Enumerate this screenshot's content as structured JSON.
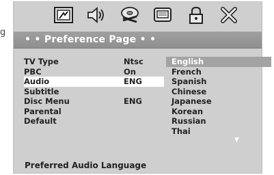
{
  "margin_glyph": "g",
  "toolbar": {
    "tabs": [
      {
        "name": "general-setup-icon"
      },
      {
        "name": "audio-setup-icon"
      },
      {
        "name": "video-setup-icon"
      },
      {
        "name": "tv-display-icon"
      },
      {
        "name": "password-lock-icon"
      },
      {
        "name": "exit-icon"
      }
    ]
  },
  "page": {
    "title": "• • Preference Page • •"
  },
  "settings": [
    {
      "label": "TV Type",
      "value": "Ntsc"
    },
    {
      "label": "PBC",
      "value": "On"
    },
    {
      "label": "Audio",
      "value": "ENG"
    },
    {
      "label": "Subtitle",
      "value": ""
    },
    {
      "label": "Disc Menu",
      "value": "ENG"
    },
    {
      "label": "Parental",
      "value": ""
    },
    {
      "label": "Default",
      "value": ""
    }
  ],
  "options": [
    "English",
    "French",
    "Spanish",
    "Chinese",
    "Japanese",
    "Korean",
    "Russian",
    "Thai"
  ],
  "scroll_arrow": "▼",
  "footer": {
    "hint": "Preferred Audio Language"
  },
  "colors": {
    "screen_bg": "#cfcfcf",
    "title_bar": "#999999",
    "highlight": "#a3a3a3"
  }
}
